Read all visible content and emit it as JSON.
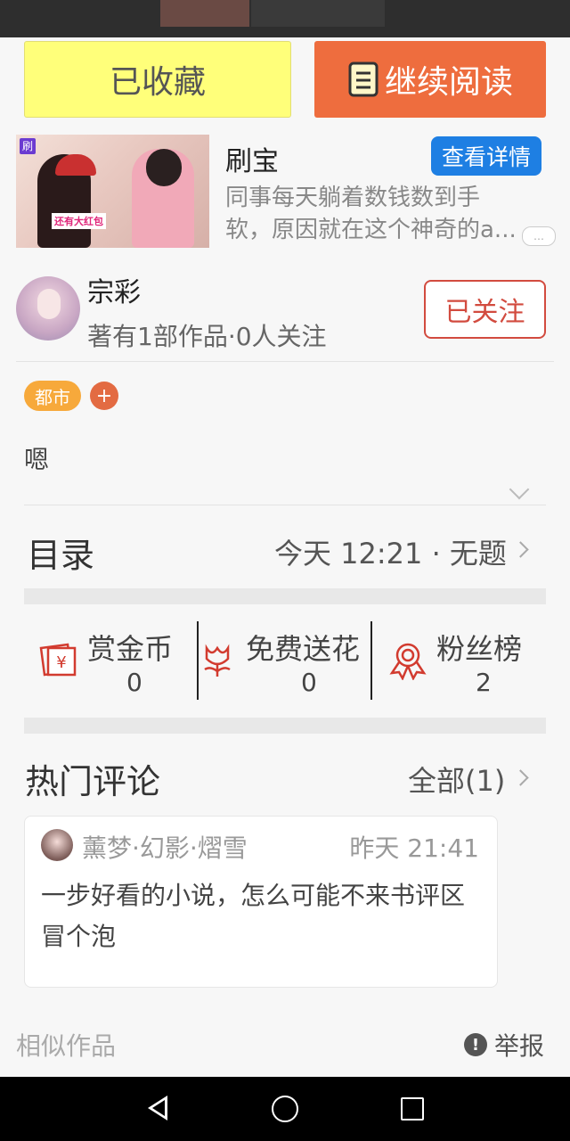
{
  "actions": {
    "favorite_label": "已收藏",
    "continue_label": "继续阅读"
  },
  "ad": {
    "title": "刷宝",
    "detail_label": "查看详情",
    "desc_line1": "同事每天躺着数钱数到手",
    "desc_line2": "软，原因就在这个神奇的a..."
  },
  "author": {
    "name": "宗彩",
    "meta": "著有1部作品·0人关注",
    "follow_label": "已关注"
  },
  "tags": {
    "genre": "都市",
    "add": "+"
  },
  "book": {
    "description": "嗯"
  },
  "toc": {
    "title": "目录",
    "latest": "今天 12:21 · 无题"
  },
  "stats": [
    {
      "label": "赏金币",
      "value": "0",
      "icon": "reward-coin-icon"
    },
    {
      "label": "免费送花",
      "value": "0",
      "icon": "flower-icon"
    },
    {
      "label": "粉丝榜",
      "value": "2",
      "icon": "medal-icon"
    }
  ],
  "comments": {
    "title": "热门评论",
    "all_label": "全部(1)",
    "items": [
      {
        "user": "薰梦·幻影·熠雪",
        "time": "昨天 21:41",
        "text": "一步好看的小说，怎么可能不来书评区冒个泡"
      }
    ]
  },
  "footer": {
    "similar": "相似作品",
    "report": "举报"
  },
  "colors": {
    "accent_orange": "#ee6d3e",
    "favorite_yellow": "#ffff7a",
    "follow_red": "#d24b3f",
    "detail_blue": "#1e7fe3",
    "tag_orange": "#f7a93b"
  }
}
